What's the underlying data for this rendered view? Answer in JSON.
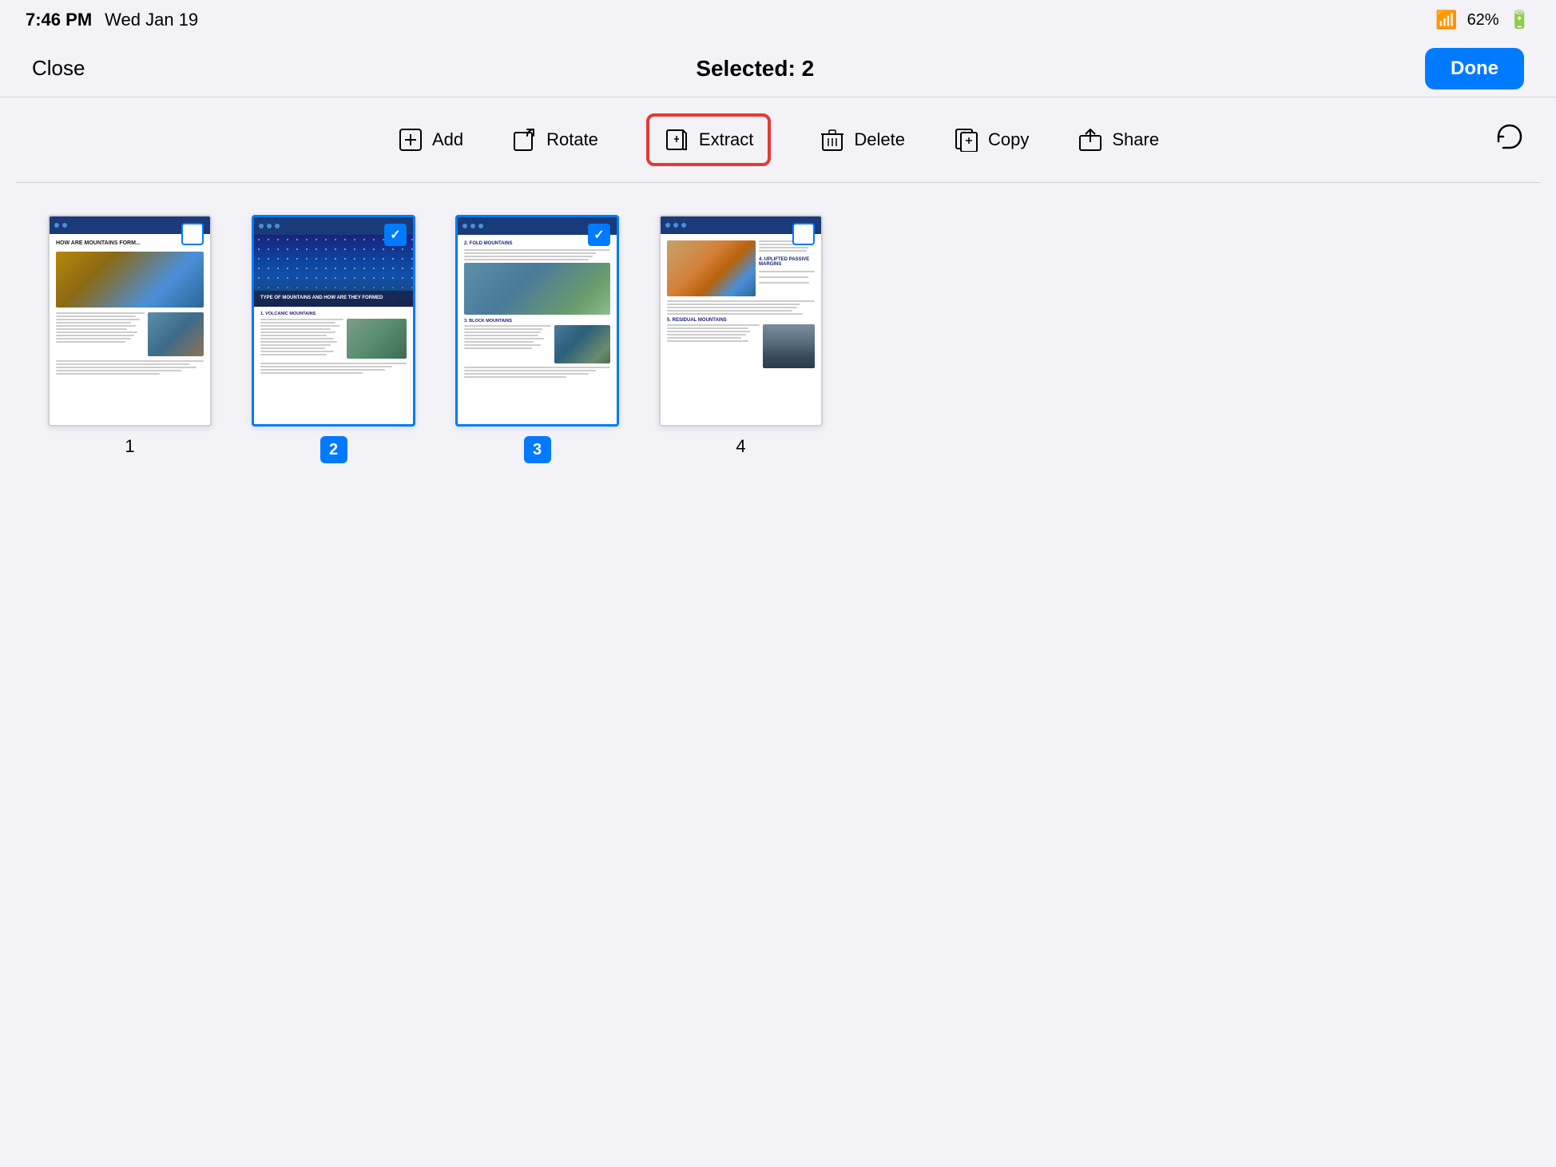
{
  "statusBar": {
    "time": "7:46 PM",
    "date": "Wed Jan 19",
    "wifi": "WiFi",
    "battery": "62%"
  },
  "header": {
    "closeLabel": "Close",
    "titleLabel": "Selected: 2",
    "doneLabel": "Done"
  },
  "toolbar": {
    "addLabel": "Add",
    "rotateLabel": "Rotate",
    "extractLabel": "Extract",
    "deleteLabel": "Delete",
    "copyLabel": "Copy",
    "shareLabel": "Share"
  },
  "pages": [
    {
      "id": 1,
      "number": "1",
      "selected": false,
      "checked": false
    },
    {
      "id": 2,
      "number": "2",
      "selected": true,
      "checked": true
    },
    {
      "id": 3,
      "number": "3",
      "selected": true,
      "checked": true
    },
    {
      "id": 4,
      "number": "4",
      "selected": false,
      "checked": false
    }
  ]
}
